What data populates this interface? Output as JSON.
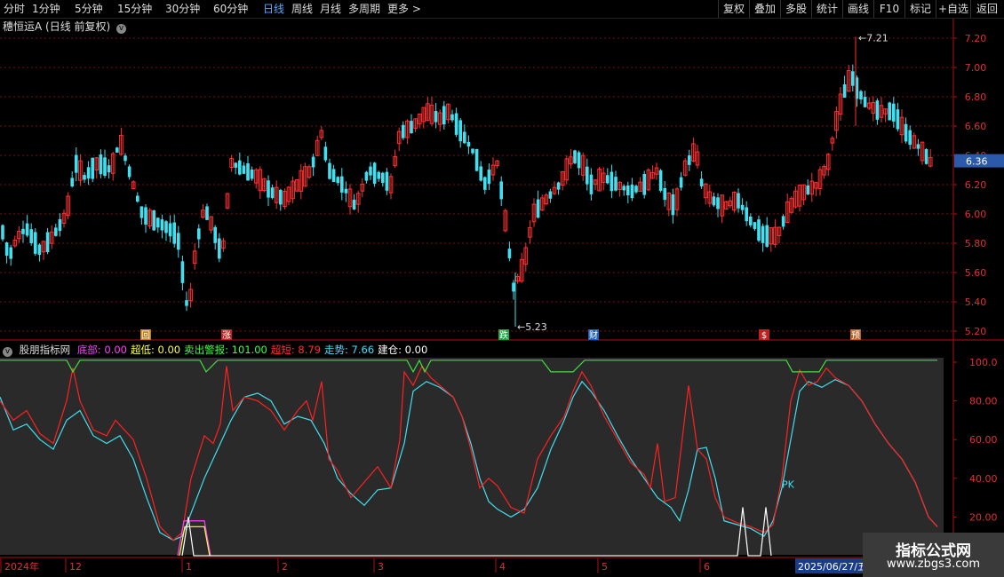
{
  "toolbar": {
    "periods": [
      "分时",
      "1分钟",
      "5分钟",
      "15分钟",
      "30分钟",
      "60分钟",
      "日线",
      "周线",
      "月线",
      "多周期",
      "更多"
    ],
    "active_period": "日线",
    "right_buttons": [
      "复权",
      "叠加",
      "多股",
      "统计",
      "画线",
      "F10",
      "+自选",
      "返回"
    ],
    "label_mark": "标记"
  },
  "stock": {
    "name": "穗恒运A",
    "mode": "(日线 前复权)"
  },
  "main_chart": {
    "y_ticks": [
      "7.20",
      "7.00",
      "6.80",
      "6.60",
      "6.40",
      "6.20",
      "6.00",
      "5.80",
      "5.60",
      "5.40",
      "5.20"
    ],
    "current_price": "6.36",
    "high_label": "7.21",
    "low_label": "5.23",
    "event_markers": [
      "回",
      "涨",
      "跌",
      "财",
      "$",
      "预"
    ]
  },
  "indicator": {
    "name": "股朋指标网",
    "fields": [
      {
        "label": "底部",
        "value": "0.00",
        "color": "#ff40ff"
      },
      {
        "label": "超低",
        "value": "0.00",
        "color": "#ffff40"
      },
      {
        "label": "卖出警报",
        "value": "101.00",
        "color": "#40ff40"
      },
      {
        "label": "超短",
        "value": "8.79",
        "color": "#ff3030"
      },
      {
        "label": "走势",
        "value": "7.66",
        "color": "#40e0ff"
      },
      {
        "label": "建仓",
        "value": "0.00",
        "color": "#ffffff"
      }
    ],
    "y_ticks": [
      "100.0",
      "80.00",
      "60.00",
      "40.00",
      "20.00"
    ],
    "pk_label": "PK"
  },
  "time_axis": {
    "labels": [
      "2024年",
      "12",
      "1",
      "2",
      "3",
      "4",
      "5",
      "6"
    ],
    "cursor_date": "2025/06/27/五"
  },
  "watermark": {
    "title": "指标公式网",
    "url": "www.zbgs3.com"
  }
}
